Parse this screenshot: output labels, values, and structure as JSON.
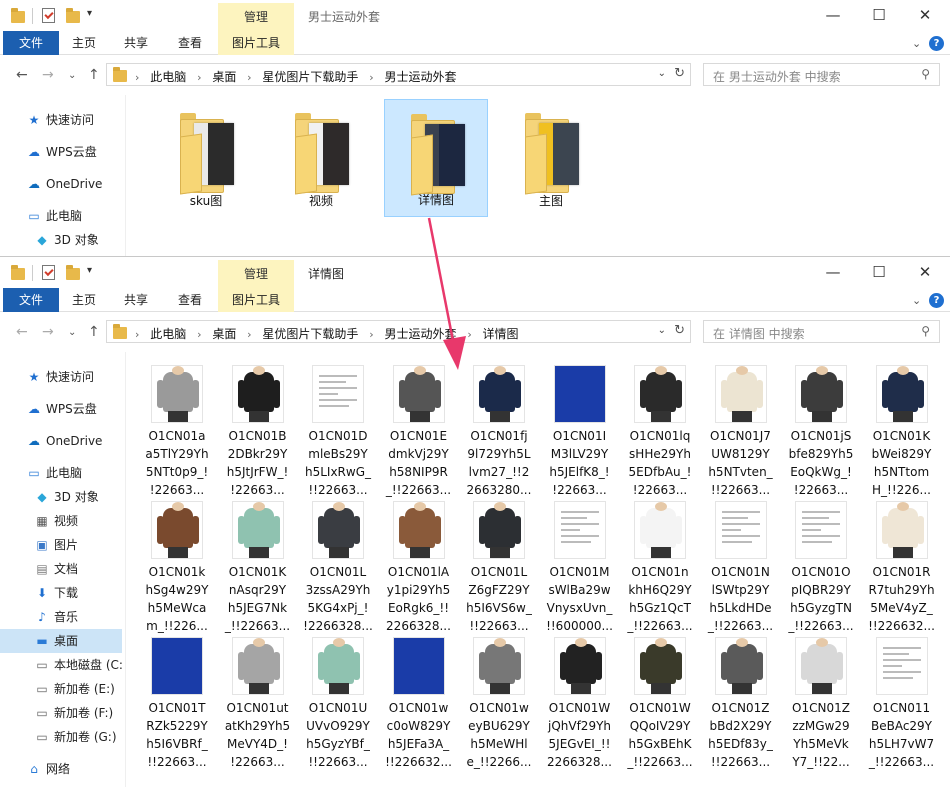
{
  "colors": {
    "accent": "#1c5fb0",
    "context": "#fdf4bf",
    "selected": "#cce4f7",
    "arrow": "#e8386b"
  },
  "ribbon": {
    "file": "文件",
    "home": "主页",
    "share": "共享",
    "view": "查看",
    "context_group": "管理",
    "picture_tools": "图片工具"
  },
  "window_top": {
    "title": "男士运动外套",
    "address": [
      "此电脑",
      "桌面",
      "星优图片下载助手",
      "男士运动外套"
    ],
    "search_placeholder": "在 男士运动外套 中搜索",
    "sidebar": [
      {
        "label": "快速访问",
        "icon": "star-icon"
      },
      {
        "label": "WPS云盘",
        "icon": "cloud-icon"
      },
      {
        "label": "OneDrive",
        "icon": "onedrive-icon"
      },
      {
        "label": "此电脑",
        "icon": "computer-icon"
      },
      {
        "label": "3D 对象",
        "icon": "cube-icon"
      }
    ],
    "folders": [
      {
        "label": "sku图",
        "selected": false
      },
      {
        "label": "视频",
        "selected": false
      },
      {
        "label": "详情图",
        "selected": true
      },
      {
        "label": "主图",
        "selected": false
      }
    ]
  },
  "window_bottom": {
    "title": "详情图",
    "address": [
      "此电脑",
      "桌面",
      "星优图片下载助手",
      "男士运动外套",
      "详情图"
    ],
    "search_placeholder": "在 详情图 中搜索",
    "sidebar": [
      {
        "label": "快速访问",
        "icon": "star-icon",
        "selected": false
      },
      {
        "label": "WPS云盘",
        "icon": "cloud-icon",
        "selected": false
      },
      {
        "label": "OneDrive",
        "icon": "onedrive-icon",
        "selected": false
      },
      {
        "label": "此电脑",
        "icon": "computer-icon",
        "selected": false
      },
      {
        "label": "3D 对象",
        "icon": "cube-icon",
        "selected": false
      },
      {
        "label": "视频",
        "icon": "video-icon",
        "selected": false
      },
      {
        "label": "图片",
        "icon": "picture-icon",
        "selected": false
      },
      {
        "label": "文档",
        "icon": "document-icon",
        "selected": false
      },
      {
        "label": "下载",
        "icon": "download-icon",
        "selected": false
      },
      {
        "label": "音乐",
        "icon": "music-icon",
        "selected": false
      },
      {
        "label": "桌面",
        "icon": "desktop-icon",
        "selected": true
      },
      {
        "label": "本地磁盘 (C:",
        "icon": "drive-icon",
        "selected": false
      },
      {
        "label": "新加卷 (E:)",
        "icon": "drive-icon",
        "selected": false
      },
      {
        "label": "新加卷 (F:)",
        "icon": "drive-icon",
        "selected": false
      },
      {
        "label": "新加卷 (G:)",
        "icon": "drive-icon",
        "selected": false
      },
      {
        "label": "网络",
        "icon": "network-icon",
        "selected": false
      }
    ],
    "files": [
      {
        "l1": "O1CN01a",
        "l2": "a5TlY29Yh",
        "l3": "5NTt0p9_!",
        "l4": "!22663..."
      },
      {
        "l1": "O1CN01B",
        "l2": "2DBkr29Y",
        "l3": "h5JtJrFW_!",
        "l4": "!22663..."
      },
      {
        "l1": "O1CN01D",
        "l2": "mleBs29Y",
        "l3": "h5LIxRwG_",
        "l4": "!!22663..."
      },
      {
        "l1": "O1CN01E",
        "l2": "dmkVj29Y",
        "l3": "h58NIP9R",
        "l4": "_!!22663..."
      },
      {
        "l1": "O1CN01fj",
        "l2": "9l729Yh5L",
        "l3": "lvm27_!!2",
        "l4": "2663280..."
      },
      {
        "l1": "O1CN01I",
        "l2": "M3lLV29Y",
        "l3": "h5JElfK8_!",
        "l4": "!22663..."
      },
      {
        "l1": "O1CN01lq",
        "l2": "sHHe29Yh",
        "l3": "5EDfbAu_!",
        "l4": "!22663..."
      },
      {
        "l1": "O1CN01J7",
        "l2": "UW8129Y",
        "l3": "h5NTvten_",
        "l4": "!!22663..."
      },
      {
        "l1": "O1CN01jS",
        "l2": "bfe829Yh5",
        "l3": "EoQkWg_!",
        "l4": "!22663..."
      },
      {
        "l1": "O1CN01K",
        "l2": "bWei829Y",
        "l3": "h5NTtom",
        "l4": "H_!!226..."
      },
      {
        "l1": "O1CN01k",
        "l2": "hSg4w29Y",
        "l3": "h5MeWca",
        "l4": "m_!!226..."
      },
      {
        "l1": "O1CN01K",
        "l2": "nAsqr29Y",
        "l3": "h5JEG7Nk",
        "l4": "_!!22663..."
      },
      {
        "l1": "O1CN01L",
        "l2": "3zssA29Yh",
        "l3": "5KG4xPj_!",
        "l4": "!2266328..."
      },
      {
        "l1": "O1CN01lA",
        "l2": "y1pi29Yh5",
        "l3": "EoRgk6_!!",
        "l4": "2266328..."
      },
      {
        "l1": "O1CN01L",
        "l2": "Z6gFZ29Y",
        "l3": "h5I6VS6w_",
        "l4": "!!22663..."
      },
      {
        "l1": "O1CN01M",
        "l2": "sWlBa29w",
        "l3": "VnysxUvn_",
        "l4": "!!600000..."
      },
      {
        "l1": "O1CN01n",
        "l2": "khH6Q29Y",
        "l3": "h5Gz1QcT",
        "l4": "_!!22663..."
      },
      {
        "l1": "O1CN01N",
        "l2": "lSWtp29Y",
        "l3": "h5LkdHDe",
        "l4": "_!!22663..."
      },
      {
        "l1": "O1CN01O",
        "l2": "pIQBR29Y",
        "l3": "h5GyzgTN",
        "l4": "_!!22663..."
      },
      {
        "l1": "O1CN01R",
        "l2": "R7tuh29Yh",
        "l3": "5MeV4yZ_",
        "l4": "!!226632..."
      },
      {
        "l1": "O1CN01T",
        "l2": "RZk5229Y",
        "l3": "h5I6VBRf_",
        "l4": "!!22663..."
      },
      {
        "l1": "O1CN01ut",
        "l2": "atKh29Yh5",
        "l3": "MeVY4D_!",
        "l4": "!22663..."
      },
      {
        "l1": "O1CN01U",
        "l2": "UVvO929Y",
        "l3": "h5GyzYBf_",
        "l4": "!!22663..."
      },
      {
        "l1": "O1CN01w",
        "l2": "c0oW829Y",
        "l3": "h5JEFa3A_",
        "l4": "!!226632..."
      },
      {
        "l1": "O1CN01w",
        "l2": "eyBU629Y",
        "l3": "h5MeWHl",
        "l4": "e_!!2266..."
      },
      {
        "l1": "O1CN01W",
        "l2": "jQhVf29Yh",
        "l3": "5JEGvEI_!!",
        "l4": "2266328..."
      },
      {
        "l1": "O1CN01W",
        "l2": "QQoIV29Y",
        "l3": "h5GxBEhK",
        "l4": "_!!22663..."
      },
      {
        "l1": "O1CN01Z",
        "l2": "bBd2X29Y",
        "l3": "h5EDf83y_",
        "l4": "!!22663..."
      },
      {
        "l1": "O1CN01Z",
        "l2": "zzMGw29",
        "l3": "Yh5MeVk",
        "l4": "Y7_!!22..."
      },
      {
        "l1": "O1CN011",
        "l2": "BeBAc29Y",
        "l3": "h5LH7vW7",
        "l4": "_!!22663..."
      }
    ]
  }
}
